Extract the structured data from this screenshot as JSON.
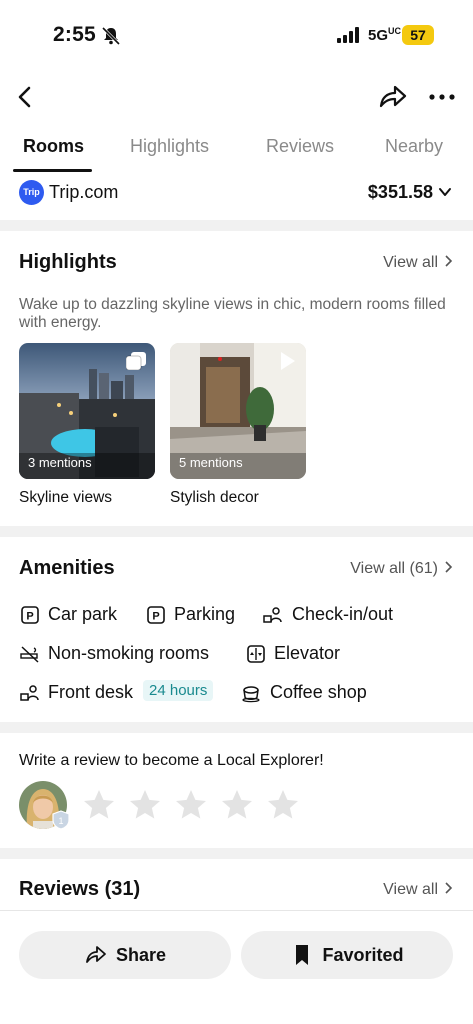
{
  "status_bar": {
    "time": "2:55",
    "network": "5G",
    "network_sup": "UC",
    "battery": "57"
  },
  "tabs": [
    {
      "label": "Rooms"
    },
    {
      "label": "Highlights"
    },
    {
      "label": "Reviews"
    },
    {
      "label": "Nearby"
    }
  ],
  "provider": {
    "logo_text": "Trip",
    "name": "Trip.com",
    "price": "$351.58"
  },
  "highlights": {
    "title": "Highlights",
    "view_all": "View all",
    "description": "Wake up to dazzling skyline views in chic, modern rooms filled with energy.",
    "cards": [
      {
        "mentions": "3 mentions",
        "caption": "Skyline views"
      },
      {
        "mentions": "5 mentions",
        "caption": "Stylish decor"
      }
    ]
  },
  "amenities": {
    "title": "Amenities",
    "view_all": "View all (61)",
    "items": [
      {
        "label": "Car park",
        "icon": "parking-icon"
      },
      {
        "label": "Parking",
        "icon": "parking-icon"
      },
      {
        "label": "Check-in/out",
        "icon": "checkin-icon"
      },
      {
        "label": "Non-smoking rooms",
        "icon": "no-smoking-icon"
      },
      {
        "label": "Elevator",
        "icon": "elevator-icon"
      },
      {
        "label": "Front desk",
        "icon": "front-desk-icon",
        "badge": "24 hours"
      },
      {
        "label": "Coffee shop",
        "icon": "coffee-icon"
      }
    ]
  },
  "review_prompt": {
    "text": "Write a review to become a Local Explorer!",
    "stars": 5
  },
  "reviews": {
    "title": "Reviews (31)",
    "view_all": "View all"
  },
  "bottom_bar": {
    "share_label": "Share",
    "favorite_label": "Favorited"
  },
  "colors": {
    "accent": "#2e5bf0",
    "battery": "#f4c90f",
    "badge_bg": "#e8f6f7",
    "badge_text": "#1a8a8f"
  }
}
